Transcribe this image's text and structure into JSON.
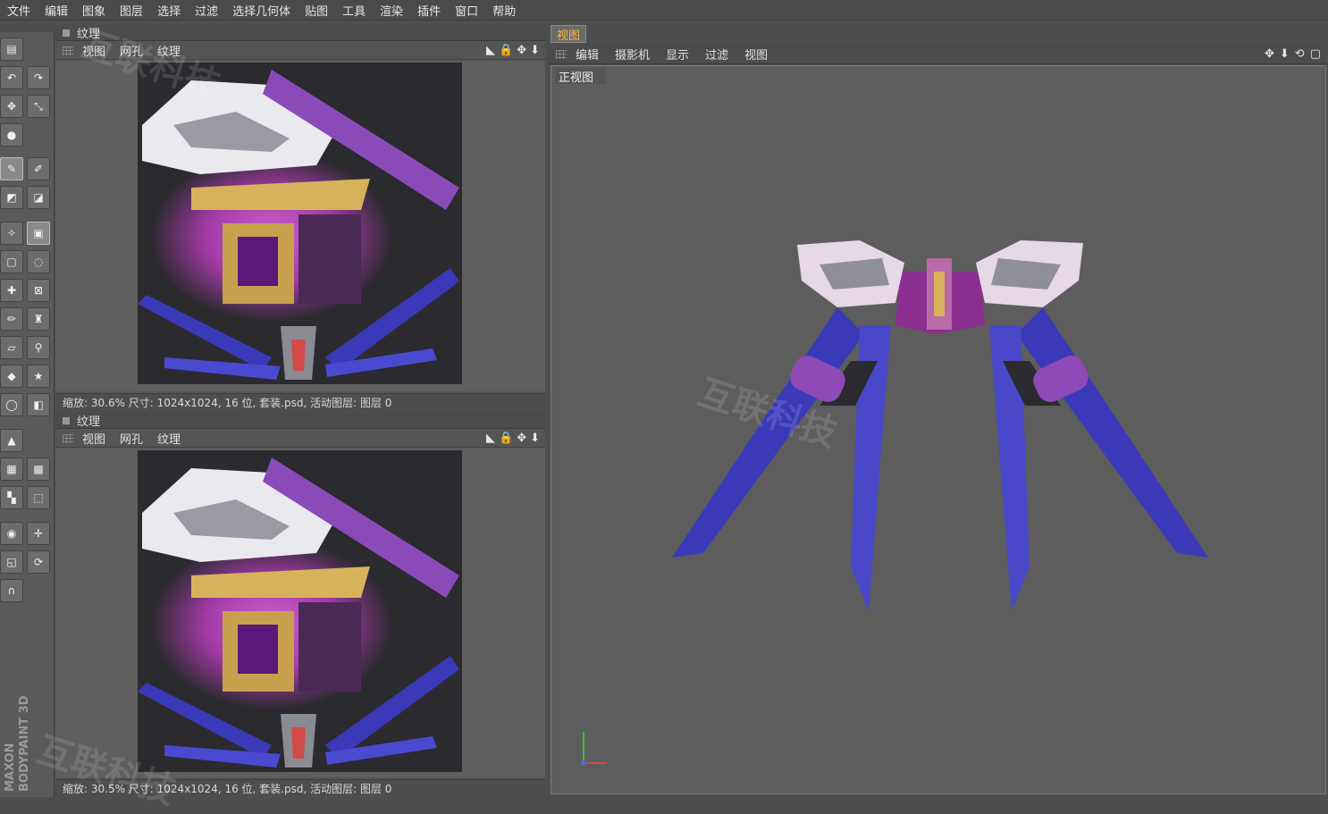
{
  "menu": [
    "文件",
    "编辑",
    "图象",
    "图层",
    "选择",
    "过滤",
    "选择几何体",
    "贴图",
    "工具",
    "渲染",
    "插件",
    "窗口",
    "帮助"
  ],
  "texture_panel_top": {
    "title": "纹理",
    "tabs": [
      "视图",
      "网孔",
      "纹理"
    ],
    "status": "缩放: 30.6%  尺寸: 1024x1024, 16 位, 套装.psd, 活动图层: 图层 0"
  },
  "texture_panel_bottom": {
    "title": "纹理",
    "tabs": [
      "视图",
      "网孔",
      "纹理"
    ],
    "status": "缩放: 30.5%  尺寸: 1024x1024, 16 位, 套装.psd, 活动图层: 图层 0"
  },
  "viewport": {
    "tab": "视图",
    "menu": [
      "编辑",
      "摄影机",
      "显示",
      "过滤",
      "视图"
    ],
    "label": "正视图"
  },
  "toolbar_brand": "MAXON BODYPAINT 3D",
  "watermark": "互联科技",
  "colors": {
    "accent_tab": "#f5b844",
    "panel_bg": "#565656",
    "texture_bg": "#2b2a2f"
  }
}
